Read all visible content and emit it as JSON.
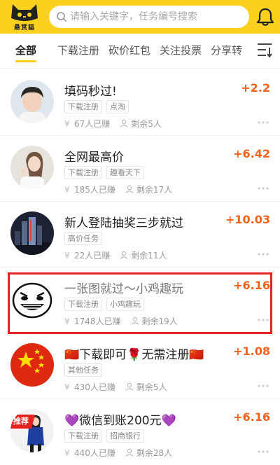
{
  "app": {
    "logo_text": "悬赏猫"
  },
  "search": {
    "placeholder": "请输入关键字，任务编号搜索"
  },
  "tabs": [
    "全部",
    "下载注册",
    "砍价红包",
    "关注投票",
    "分享转"
  ],
  "tasks": [
    {
      "title": "填码秒过!",
      "price": "+2.2",
      "tags": [
        "下载注册",
        "点淘"
      ],
      "earned": "67人已赚",
      "remaining": "剩余5人"
    },
    {
      "title": "全网最高价",
      "price": "+6.42",
      "tags": [
        "下载注册",
        "趣看天下"
      ],
      "earned": "185人已赚",
      "remaining": "剩余17人"
    },
    {
      "title": "新人登陆抽奖三步就过",
      "price": "+10.03",
      "tags": [
        "高价任务"
      ],
      "earned": "22人已赚",
      "remaining": "剩余11人"
    },
    {
      "title": "一张图就过～小鸡趣玩",
      "price": "+6.16",
      "tags": [
        "下载注册",
        "小鸡趣玩"
      ],
      "earned": "1748人已赚",
      "remaining": "剩余19人"
    },
    {
      "title": "🇨🇳下载即可🌹无需注册🇨🇳",
      "price": "+1.08",
      "tags": [
        "其他任务"
      ],
      "earned": "430人已赚",
      "remaining": "剩余5人"
    },
    {
      "title": "💜微信到账200元💜",
      "price": "+6.16",
      "tags": [
        "下载注册",
        "招商银行"
      ],
      "earned": "440人已赚",
      "remaining": "剩余28人"
    }
  ],
  "badge": {
    "recommend": "推荐"
  },
  "colors": {
    "brand_yellow": "#fcd01c",
    "price_orange": "#f0621e",
    "highlight_red": "#e52421"
  }
}
